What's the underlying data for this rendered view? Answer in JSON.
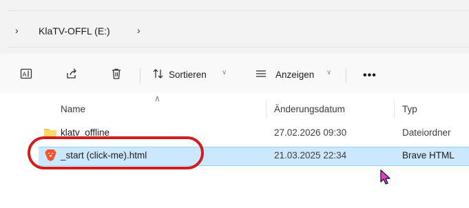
{
  "breadcrumb": {
    "items": [
      {
        "label": "KlaTV-OFFL (E:)"
      }
    ]
  },
  "toolbar": {
    "sort_label": "Sortieren",
    "view_label": "Anzeigen",
    "more_label": "•••"
  },
  "columns": {
    "name": "Name",
    "date": "Änderungsdatum",
    "type": "Typ"
  },
  "files": [
    {
      "name": "klatv_offline",
      "date": "27.02.2026 09:30",
      "type": "Dateiordner",
      "icon": "folder-icon",
      "selected": false
    },
    {
      "name": "_start (click-me).html",
      "date": "21.03.2025 22:34",
      "type": "Brave HTML",
      "icon": "brave-icon",
      "selected": true
    }
  ],
  "colors": {
    "selection": "#cce8ff",
    "annotation": "#d21d1d",
    "cursor": "#c000c0"
  }
}
